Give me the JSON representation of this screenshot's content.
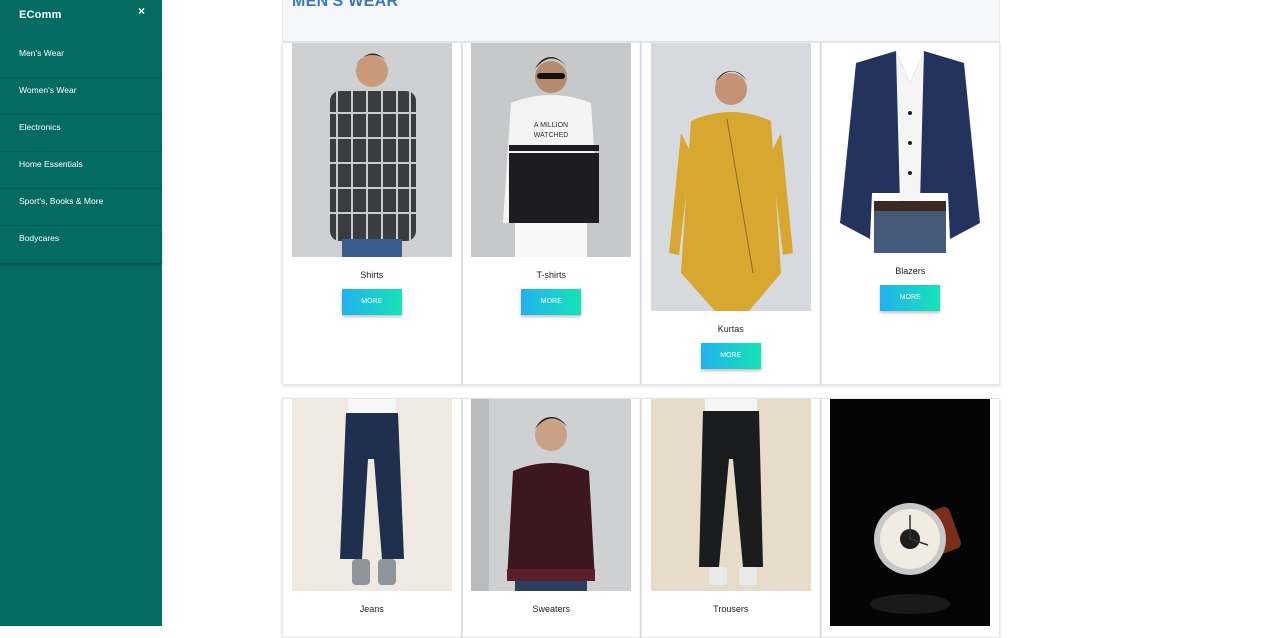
{
  "sidebar": {
    "brand": "EComm",
    "close": "×",
    "items": [
      {
        "label": "Men's Wear"
      },
      {
        "label": "Women's Wear"
      },
      {
        "label": "Electronics"
      },
      {
        "label": "Home Essentials"
      },
      {
        "label": "Sport's, Books & More"
      },
      {
        "label": "Bodycares"
      }
    ]
  },
  "main": {
    "title": "MEN'S WEAR",
    "button_label": "MORE",
    "products": [
      {
        "name": "Shirts"
      },
      {
        "name": "T-shirts"
      },
      {
        "name": "Kurtas"
      },
      {
        "name": "Blazers"
      },
      {
        "name": "Jeans"
      },
      {
        "name": "Sweaters"
      },
      {
        "name": "Trousers"
      },
      {
        "name": ""
      }
    ]
  },
  "colors": {
    "sidebar_bg": "#036b62",
    "title": "#3d78b6",
    "button_gradient_start": "#22b1ee",
    "button_gradient_end": "#15e3b6"
  }
}
